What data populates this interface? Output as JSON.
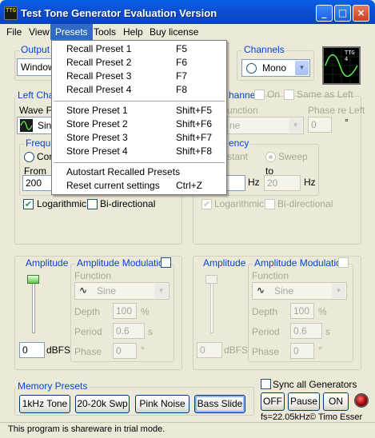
{
  "window": {
    "title": "Test Tone Generator Evaluation Version",
    "app_icon_text": "TTG",
    "buttons": {
      "minimize": "_",
      "maximize": "□",
      "close": "×"
    }
  },
  "menubar": {
    "file": "File",
    "view": "View",
    "presets": "Presets",
    "tools": "Tools",
    "help": "Help",
    "buy": "Buy license"
  },
  "presets_menu": {
    "recall": [
      {
        "label": "Recall Preset 1",
        "key": "F5"
      },
      {
        "label": "Recall Preset 2",
        "key": "F6"
      },
      {
        "label": "Recall Preset 3",
        "key": "F7"
      },
      {
        "label": "Recall Preset 4",
        "key": "F8"
      }
    ],
    "store": [
      {
        "label": "Store Preset 1",
        "key": "Shift+F5"
      },
      {
        "label": "Store Preset 2",
        "key": "Shift+F6"
      },
      {
        "label": "Store Preset 3",
        "key": "Shift+F7"
      },
      {
        "label": "Store Preset 4",
        "key": "Shift+F8"
      }
    ],
    "autostart": "Autostart Recalled Presets",
    "reset": {
      "label": "Reset current settings",
      "key": "Ctrl+Z"
    }
  },
  "output": {
    "label": "Output D",
    "device": "Window"
  },
  "channels": {
    "label": "Channels",
    "value": "Mono"
  },
  "scope": {
    "text": "TTG\n4"
  },
  "left_channel": {
    "label": "Left Chan",
    "waveform_label": "Wave Fo",
    "waveform_value": "Sin",
    "frequency_label": "Freque",
    "constant_label": "Con",
    "from_label": "From",
    "from_value": "200",
    "logarithmic": "Logarithmic",
    "bidirectional": "Bi-directional",
    "logarithmic_checked": true
  },
  "right_channel": {
    "label": "hannel",
    "on_label": "On",
    "same_as_left": "Same as Left",
    "function_label": "unction",
    "function_value": "ne",
    "phase_label": "Phase re Left",
    "phase_value": "0",
    "phase_unit": "°",
    "frequency_label": "ency",
    "constant_label": "stant",
    "sweep_label": "Sweep",
    "to_label": "to",
    "to_value": "20",
    "hz1": "Hz",
    "hz2": "Hz",
    "logarithmic": "Logarithmic",
    "bidirectional": "Bi-directional"
  },
  "left_amp": {
    "amplitude_label": "Amplitude",
    "value": "0",
    "unit": "dBFS",
    "mod_label": "Amplitude Modulation",
    "function_label": "Function",
    "function_value": "Sine",
    "depth_label": "Depth",
    "depth_value": "100",
    "depth_unit": "%",
    "period_label": "Period",
    "period_value": "0.6",
    "period_unit": "s",
    "phase_label": "Phase",
    "phase_value": "0",
    "phase_unit": "°"
  },
  "right_amp": {
    "amplitude_label": "Amplitude",
    "value": "0",
    "unit": "dBFS",
    "mod_label": "Amplitude Modulation",
    "function_label": "Function",
    "function_value": "Sine",
    "depth_label": "Depth",
    "depth_value": "100",
    "depth_unit": "%",
    "period_label": "Period",
    "period_value": "0.6",
    "period_unit": "s",
    "phase_label": "Phase",
    "phase_value": "0",
    "phase_unit": "°"
  },
  "memory_presets": {
    "label": "Memory Presets",
    "buttons": [
      "1kHz Tone",
      "20-20k Swp",
      "Pink Noise",
      "Bass Slide"
    ]
  },
  "sync": {
    "label": "Sync all Generators"
  },
  "transport": {
    "off": "OFF",
    "pause": "Pause",
    "on": "ON"
  },
  "sample_rate": "fs=22.05kHz",
  "copyright": "© Timo Esser",
  "status": "This program is shareware in trial mode."
}
